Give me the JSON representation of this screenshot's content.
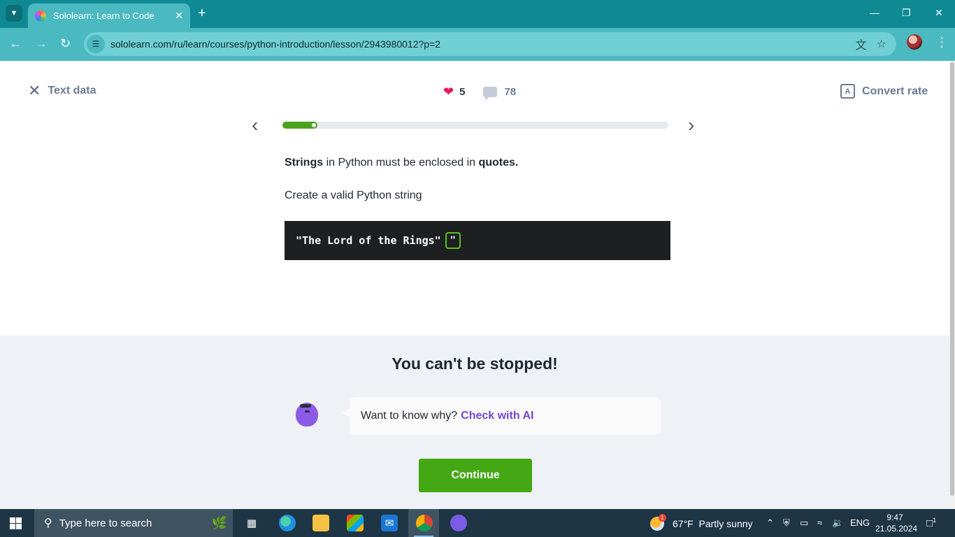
{
  "browser": {
    "tab_title": "Sololearn: Learn to Code",
    "url": "sololearn.com/ru/learn/courses/python-introduction/lesson/2943980012?p=2",
    "icons": [
      "tab-dropdown-icon",
      "close-icon",
      "new-tab-icon",
      "minimize-icon",
      "restore-icon",
      "close-window-icon",
      "back-icon",
      "forward-icon",
      "reload-icon",
      "site-info-icon",
      "translate-icon",
      "bookmark-star-icon",
      "profile-avatar",
      "menu-icon"
    ]
  },
  "header": {
    "left_label": "Text data",
    "hearts": "5",
    "comments": "78",
    "right_label": "Convert rate"
  },
  "lesson": {
    "progress": 0.09,
    "text_bold_1": "Strings",
    "text_mid": " in Python must be enclosed in ",
    "text_bold_2": "quotes.",
    "instruction": "Create a valid Python string",
    "code": "\"The Lord of the Rings\"",
    "slot_answer": "\""
  },
  "feedback": {
    "title": "You can't be stopped!",
    "question": "Want to know why?",
    "ai_link": "Check with AI",
    "continue_label": "Continue"
  },
  "taskbar": {
    "search_placeholder": "Type here to search",
    "weather_badge": "1",
    "weather": "67°F  Partly sunny",
    "language": "ENG",
    "time": "9:47",
    "date": "21.05.2024",
    "notifications": "1"
  },
  "colors": {
    "accent_green": "#44a714",
    "ai_purple": "#7446d1",
    "heart_red": "#ea1a53",
    "browser_teal": "#4ab9c0"
  }
}
